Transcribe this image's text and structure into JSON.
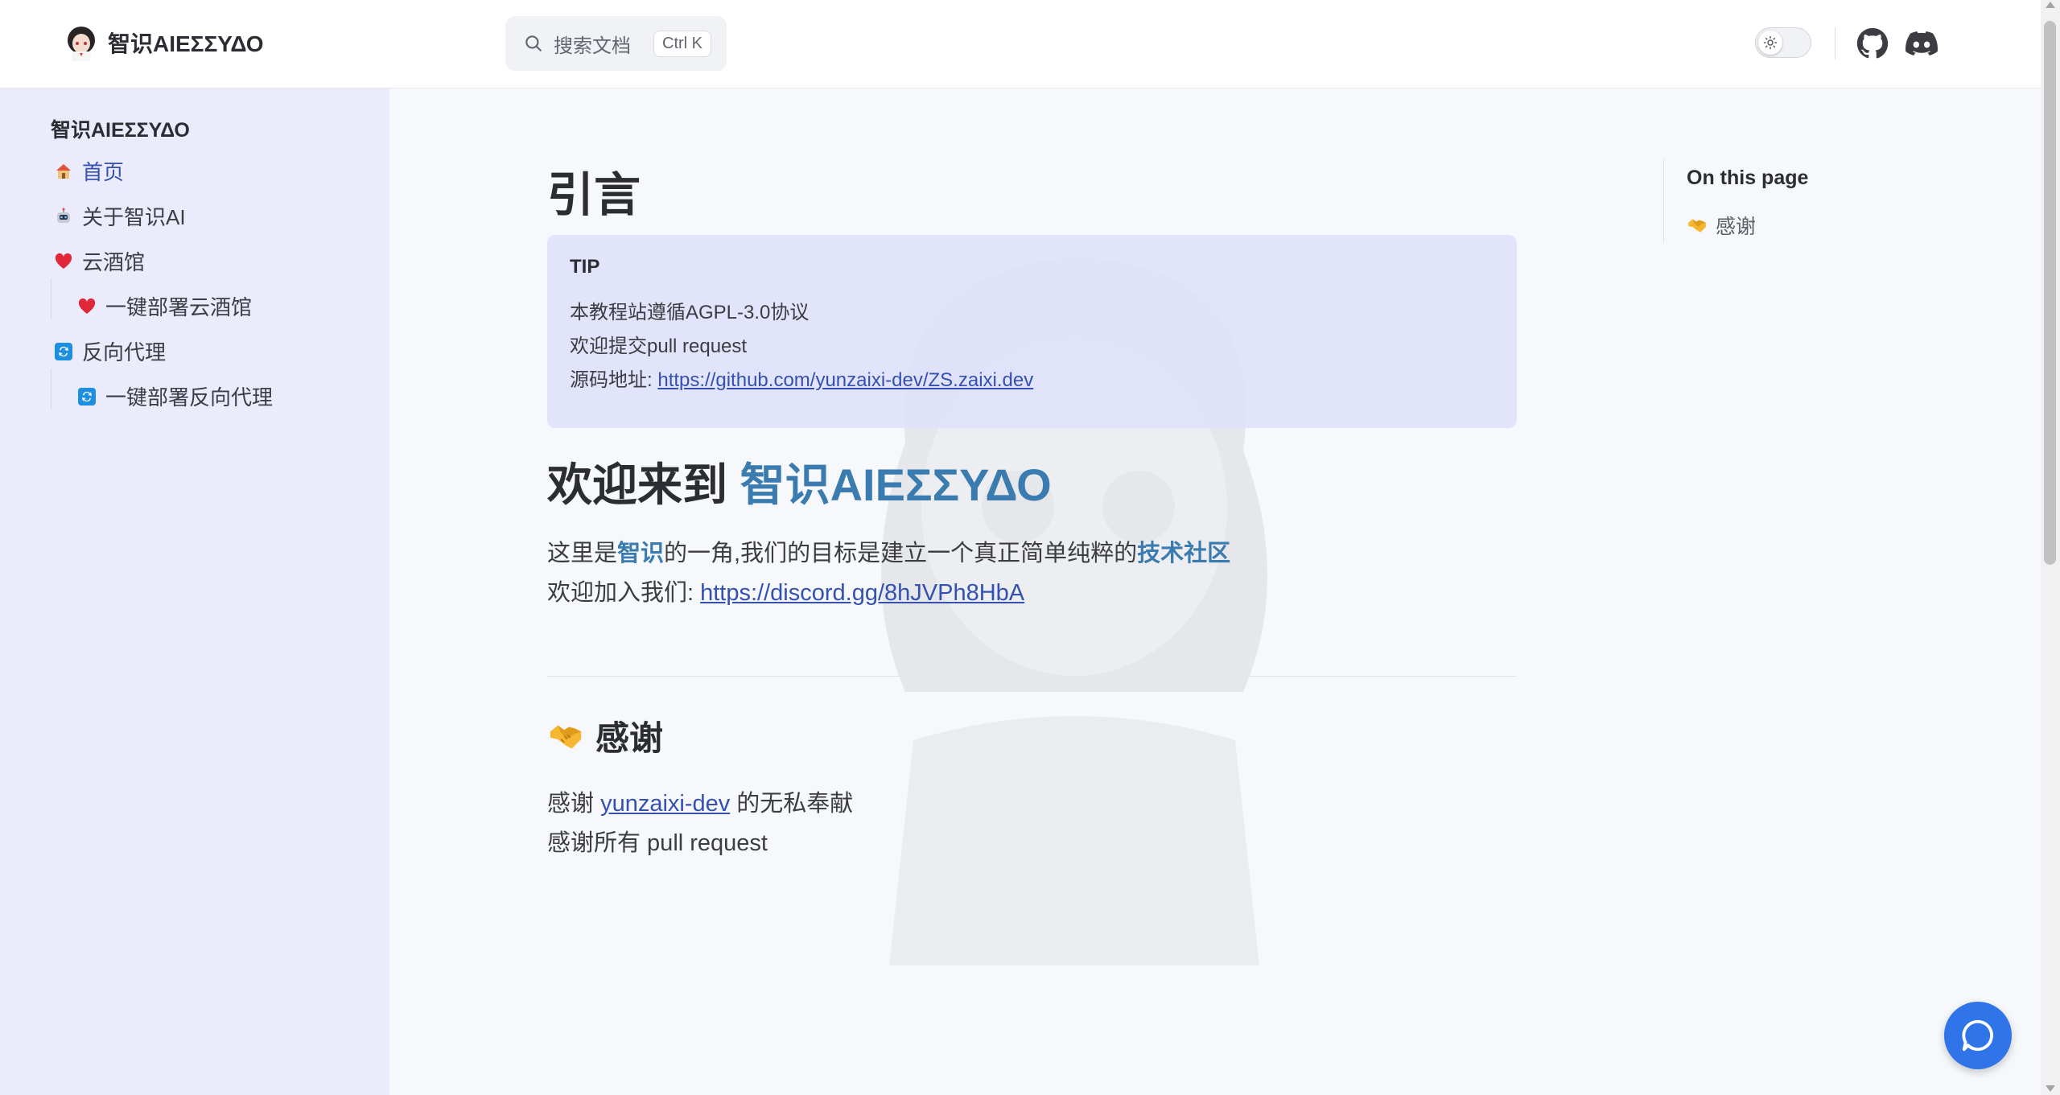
{
  "header": {
    "site_title": "智识AIΕΣΣΥΔΟ",
    "search": {
      "placeholder": "搜索文档",
      "shortcut": "Ctrl K"
    }
  },
  "icons": {
    "logo": "avatar-logo-icon",
    "search": "search-icon",
    "theme": "sun-icon",
    "github": "github-icon",
    "discord": "discord-icon",
    "chat": "chat-bubble-icon"
  },
  "sidebar": {
    "title": "智识AIΕΣΣΥΔΟ",
    "items": [
      {
        "label": "首页",
        "icon": "house-icon",
        "active": true
      },
      {
        "label": "关于智识AI",
        "icon": "robot-icon"
      },
      {
        "label": "云酒馆",
        "icon": "heart-icon"
      },
      {
        "label": "一键部署云酒馆",
        "icon": "heart-icon",
        "nested": true
      },
      {
        "label": "反向代理",
        "icon": "repeat-icon"
      },
      {
        "label": "一键部署反向代理",
        "icon": "repeat-icon",
        "nested": true
      }
    ]
  },
  "main": {
    "title": "引言",
    "tip": {
      "label": "TIP",
      "line1": "本教程站遵循AGPL-3.0协议",
      "line2": "欢迎提交pull request",
      "source_label": "源码地址: ",
      "source_link": "https://github.com/yunzaixi-dev/ZS.zaixi.dev"
    },
    "welcome": {
      "prefix": "欢迎来到 ",
      "name": "智识AIΕΣΣΥΔΟ"
    },
    "intro": {
      "part1": "这里是",
      "hl1": "智识",
      "part2": "的一角,我们的目标是建立一个真正简单纯粹的",
      "hl2": "技术社区"
    },
    "join": {
      "label": "欢迎加入我们: ",
      "link": "https://discord.gg/8hJVPh8HbA"
    },
    "thanks": {
      "heading": "感谢",
      "icon": "handshake-icon",
      "line1_prefix": "感谢 ",
      "line1_link": "yunzaixi-dev",
      "line1_suffix": " 的无私奉献",
      "line2": "感谢所有 pull request"
    }
  },
  "outline": {
    "title": "On this page",
    "items": [
      {
        "label": "感谢",
        "icon": "handshake-icon"
      }
    ]
  },
  "colors": {
    "accent": "#3a7bb0",
    "link": "#3451b2",
    "sidebar_bg": "#ebebfc",
    "tip_bg": "#dee2fa",
    "chat_button": "#2f74e8"
  }
}
